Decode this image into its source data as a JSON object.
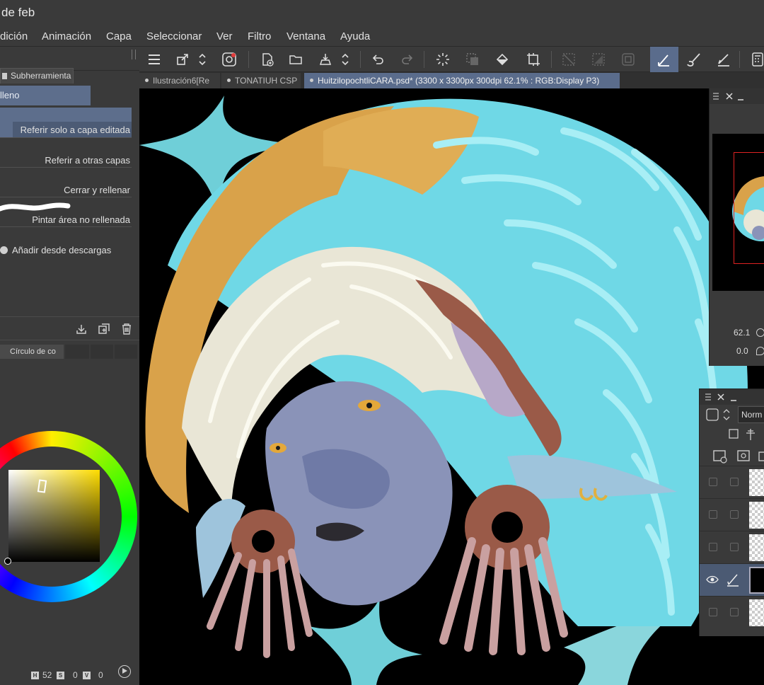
{
  "window": {
    "title": "de feb"
  },
  "menu": [
    "dición",
    "Animación",
    "Capa",
    "Seleccionar",
    "Ver",
    "Filtro",
    "Ventana",
    "Ayuda"
  ],
  "left_panel": {
    "subtool_tab": "Subherramienta",
    "subtool_group": "lleno",
    "options": [
      "Referir solo a capa editada",
      "Referir a otras capas",
      "Cerrar y rellenar",
      "Pintar área no rellenada"
    ],
    "selected_option": "Referir solo a capa editada",
    "add_from_downloads": "Añadir desde descargas"
  },
  "color_panel": {
    "tab_label": "Círculo de co",
    "hue_label": "H",
    "hue": "52",
    "sat_label": "S",
    "sat": "0",
    "val_label": "V",
    "val": "0",
    "current_hue_color": "#ffdd00"
  },
  "tabs": [
    {
      "label": "Ilustración6[Re"
    },
    {
      "label": "TONATIUH CSP"
    },
    {
      "label": "HuitzilopochtliCARA.psd* (3300 x 3300px 300dpi 62.1% : RGB:Display P3)"
    }
  ],
  "navigator": {
    "zoom": "62.1",
    "rotation": "0.0"
  },
  "layers": {
    "blend_mode": "Norm"
  },
  "colors": {
    "accent": "#5a6c8c",
    "panel": "#3a3a3a",
    "feathers": "#7ee6f0",
    "crest": "#d9a24a"
  }
}
